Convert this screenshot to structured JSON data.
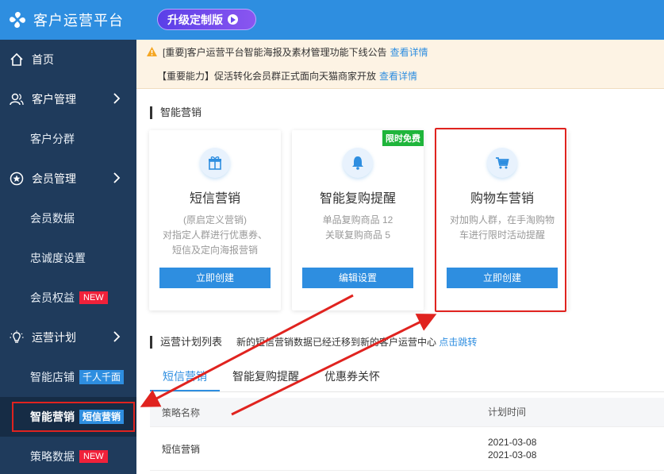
{
  "brand": {
    "title": "客户运营平台"
  },
  "topbar": {
    "upgrade_label": "升级定制版"
  },
  "sidebar": {
    "items": [
      {
        "label": "首页"
      },
      {
        "label": "客户管理"
      },
      {
        "label": "客户分群"
      },
      {
        "label": "会员管理"
      },
      {
        "label": "会员数据"
      },
      {
        "label": "忠诚度设置"
      },
      {
        "label": "会员权益",
        "badge": "NEW"
      },
      {
        "label": "运营计划"
      },
      {
        "label": "智能店铺",
        "badge": "千人千面"
      },
      {
        "label": "智能营销",
        "badge": "短信营销"
      },
      {
        "label": "策略数据",
        "badge": "NEW"
      }
    ]
  },
  "notices": [
    {
      "text": "[重要]客户运营平台智能海报及素材管理功能下线公告",
      "link": "查看详情"
    },
    {
      "text": "【重要能力】促活转化会员群正式面向天猫商家开放",
      "link": "查看详情"
    }
  ],
  "section": {
    "title": "智能营销"
  },
  "cards": [
    {
      "title": "短信营销",
      "desc": [
        "(原启定义营销)",
        "对指定人群进行优惠券、",
        "短信及定向海报营销"
      ],
      "button": "立即创建"
    },
    {
      "title": "智能复购提醒",
      "desc": [
        "单品复购商品 12",
        "关联复购商品 5"
      ],
      "button": "编辑设置",
      "tag": "限时免费"
    },
    {
      "title": "购物车营销",
      "desc": [
        "对加购人群，在手淘购物",
        "车进行限时活动提醒"
      ],
      "button": "立即创建"
    }
  ],
  "plans": {
    "title": "运营计划列表",
    "note": "新的短信营销数据已经迁移到新的客户运营中心",
    "note_link": "点击跳转",
    "tabs": [
      "短信营销",
      "智能复购提醒",
      "优惠券关怀"
    ],
    "columns": [
      "策略名称",
      "计划时间"
    ],
    "rows": [
      {
        "name": "短信营销",
        "time1": "2021-03-08",
        "time2": "2021-03-08"
      }
    ]
  },
  "colors": {
    "primary": "#2e8ee0",
    "sidebar": "#1f3b5c",
    "highlight": "#e0231f",
    "free_tag": "#1fb53b"
  }
}
